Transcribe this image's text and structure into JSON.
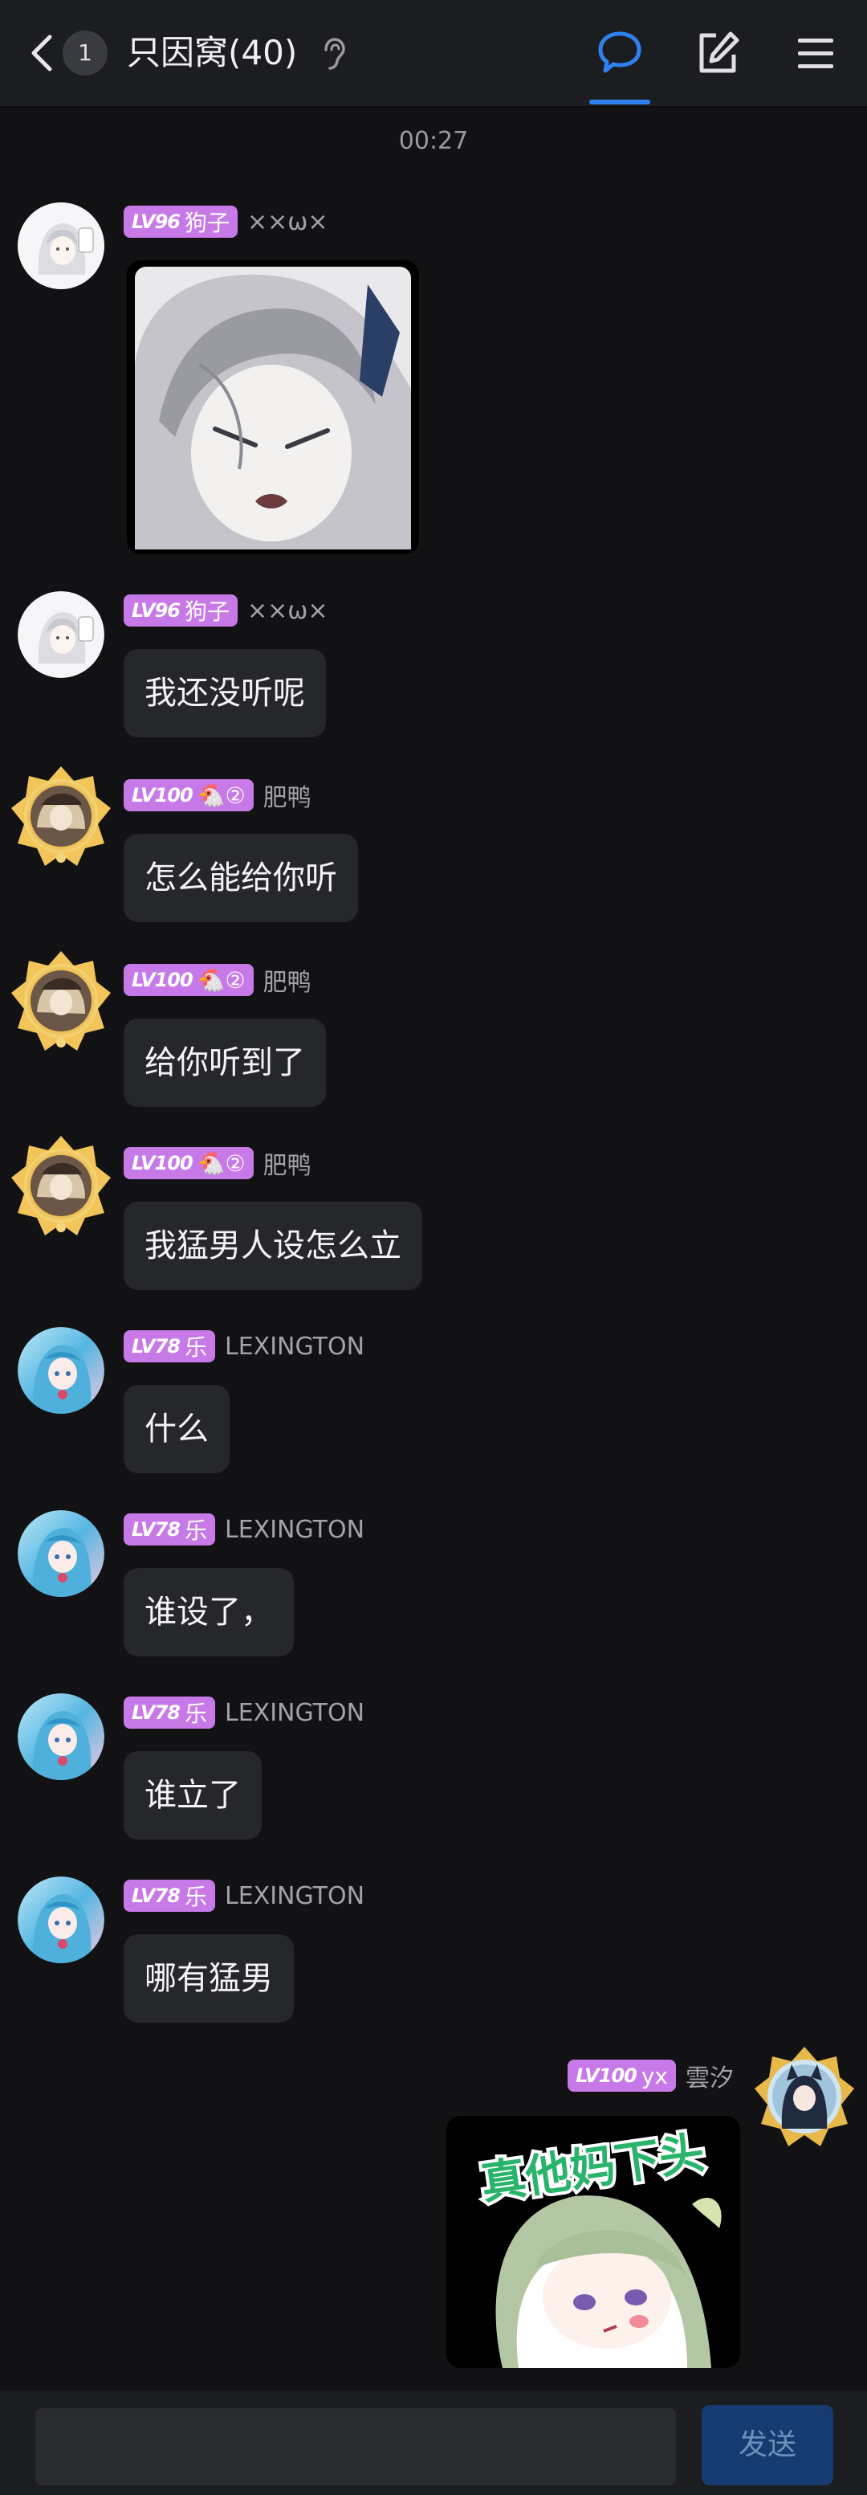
{
  "header": {
    "unread_count": "1",
    "title": "只因窝(40)",
    "icons": [
      "chevron-left-icon",
      "ear-icon",
      "chat-bubble-icon",
      "edit-icon",
      "menu-icon"
    ],
    "accent_color": "#2e82f0"
  },
  "timestamp": "00:27",
  "messages": [
    {
      "level": "LV96",
      "tag": "狗子",
      "user": "××ω×",
      "content_type": "image"
    },
    {
      "level": "LV96",
      "tag": "狗子",
      "user": "××ω×",
      "text": "我还没听呢"
    },
    {
      "level": "LV100",
      "tag": "🐔②",
      "user": "肥鸭",
      "text": "怎么能给你听"
    },
    {
      "level": "LV100",
      "tag": "🐔②",
      "user": "肥鸭",
      "text": "给你听到了"
    },
    {
      "level": "LV100",
      "tag": "🐔②",
      "user": "肥鸭",
      "text": "我猛男人设怎么立"
    },
    {
      "level": "LV78",
      "tag": "乐",
      "user": "LEXINGTON",
      "text": "什么"
    },
    {
      "level": "LV78",
      "tag": "乐",
      "user": "LEXINGTON",
      "text": "谁设了，"
    },
    {
      "level": "LV78",
      "tag": "乐",
      "user": "LEXINGTON",
      "text": "谁立了"
    },
    {
      "level": "LV78",
      "tag": "乐",
      "user": "LEXINGTON",
      "text": "哪有猛男"
    },
    {
      "level": "LV100",
      "tag": "yx",
      "user": "雲汐",
      "content_type": "sticker",
      "sticker_text": "真他妈下头"
    }
  ],
  "input": {
    "value": "",
    "placeholder": ""
  },
  "send_label": "发送",
  "colors": {
    "badge": "#c879e8",
    "bubble": "#26272b",
    "background": "#121214",
    "send_button": "#153b70"
  }
}
